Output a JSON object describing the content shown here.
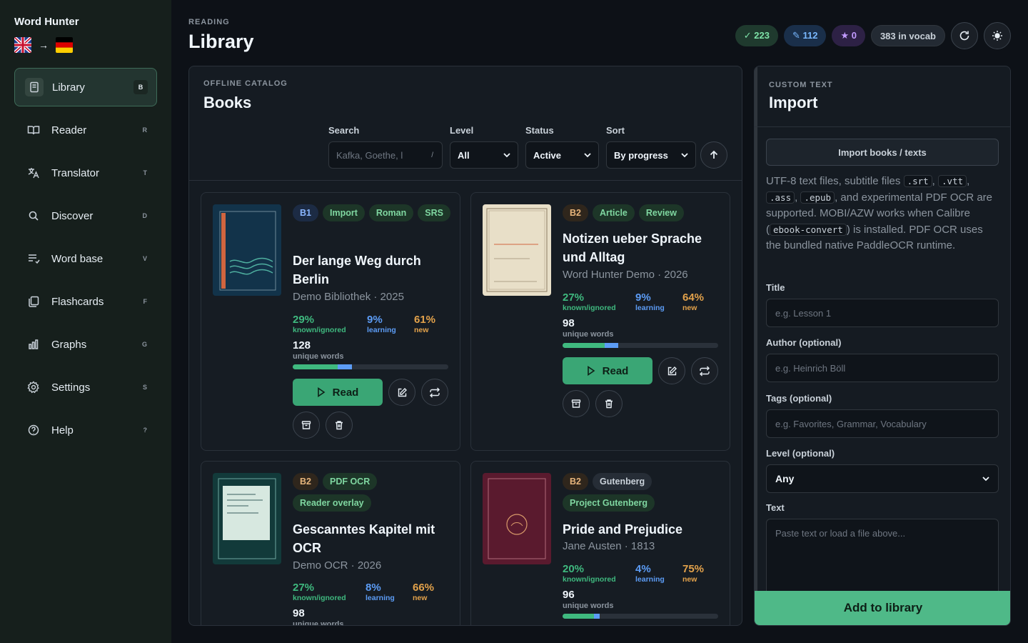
{
  "app": {
    "name": "Word Hunter",
    "source_lang": "English",
    "target_lang": "German"
  },
  "sidebar": {
    "items": [
      {
        "label": "Library",
        "key": "B",
        "icon": "book-icon",
        "active": true
      },
      {
        "label": "Reader",
        "key": "R",
        "icon": "open-book-icon"
      },
      {
        "label": "Translator",
        "key": "T",
        "icon": "translate-icon"
      },
      {
        "label": "Discover",
        "key": "D",
        "icon": "search-icon"
      },
      {
        "label": "Word base",
        "key": "V",
        "icon": "list-icon"
      },
      {
        "label": "Flashcards",
        "key": "F",
        "icon": "cards-icon"
      },
      {
        "label": "Graphs",
        "key": "G",
        "icon": "bar-chart-icon"
      },
      {
        "label": "Settings",
        "key": "S",
        "icon": "gear-icon"
      },
      {
        "label": "Help",
        "key": "?",
        "icon": "help-icon"
      }
    ]
  },
  "header": {
    "eyebrow": "READING",
    "title": "Library",
    "stats": {
      "known": "✓ 223",
      "learning": "✎ 112",
      "starred": "★ 0",
      "vocab": "383 in vocab"
    }
  },
  "catalog": {
    "eyebrow": "OFFLINE CATALOG",
    "title": "Books",
    "search": {
      "label": "Search",
      "placeholder": "Kafka, Goethe, l",
      "shortcut": "/"
    },
    "level": {
      "label": "Level",
      "value": "All"
    },
    "status": {
      "label": "Status",
      "value": "Active"
    },
    "sort": {
      "label": "Sort",
      "value": "By progress"
    },
    "books": [
      {
        "level": "B1",
        "tags": [
          "Import",
          "Roman",
          "SRS"
        ],
        "title": "Der lange Weg durch Berlin",
        "meta": "Demo Bibliothek · 2025",
        "cover_title": "DER LANGE WEG DURCH BERLIN",
        "known": "29%",
        "learning": "9%",
        "new": "61%",
        "known_frac": 0.29,
        "learning_frac": 0.09,
        "unique_words": "128",
        "read_label": "Read"
      },
      {
        "level": "B2",
        "tags": [
          "Article",
          "Review"
        ],
        "title": "Notizen ueber Sprache und Alltag",
        "meta": "Word Hunter Demo · 2026",
        "cover_title": "NOTIZEN UEBER SPRACHE UND ALLTAG",
        "known": "27%",
        "learning": "9%",
        "new": "64%",
        "known_frac": 0.27,
        "learning_frac": 0.09,
        "unique_words": "98",
        "read_label": "Read"
      },
      {
        "level": "B2",
        "tags": [
          "PDF OCR",
          "Reader overlay"
        ],
        "title": "Gescanntes Kapitel mit OCR",
        "meta": "Demo OCR · 2026",
        "known": "27%",
        "learning": "8%",
        "new": "66%",
        "unique_words": "98"
      },
      {
        "level": "B2",
        "tags": [
          "Gutenberg",
          "Project Gutenberg"
        ],
        "title": "Pride and Prejudice",
        "meta": "Jane Austen · 1813",
        "cover_title": "PRIDE AND PREJUDICE",
        "known": "20%",
        "learning": "4%",
        "new": "75%",
        "known_frac": 0.2,
        "learning_frac": 0.04,
        "unique_words": "96"
      }
    ],
    "labels": {
      "known": "known/ignored",
      "learning": "learning",
      "new": "new",
      "unique": "unique words"
    }
  },
  "import": {
    "eyebrow": "CUSTOM TEXT",
    "title": "Import",
    "button": "Import books / texts",
    "desc_1": "UTF-8 text files, subtitle files",
    "code_srt": ".srt",
    "code_vtt": ".vtt",
    "code_ass": ".ass",
    "code_epub": ".epub",
    "desc_2": ", and experimental PDF OCR are supported. MOBI/AZW works when Calibre (",
    "code_convert": "ebook-convert",
    "desc_3": ") is installed. PDF OCR uses the bundled native PaddleOCR runtime.",
    "title_label": "Title",
    "title_placeholder": "e.g. Lesson 1",
    "author_label": "Author (optional)",
    "author_placeholder": "e.g. Heinrich Böll",
    "tags_label": "Tags (optional)",
    "tags_placeholder": "e.g. Favorites, Grammar, Vocabulary",
    "level_label": "Level (optional)",
    "level_value": "Any",
    "text_label": "Text",
    "text_placeholder": "Paste text or load a file above...",
    "add_button": "Add to library"
  }
}
